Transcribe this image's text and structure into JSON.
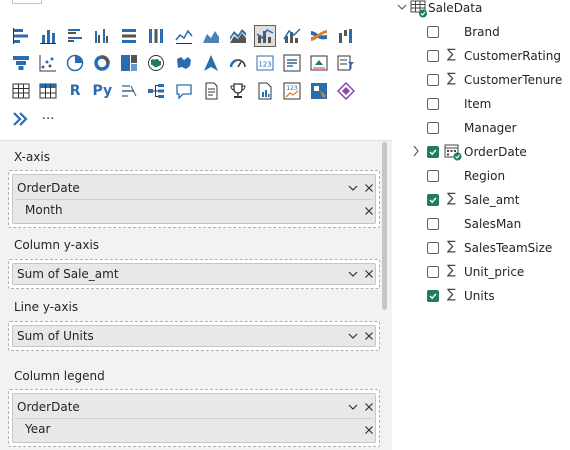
{
  "visualizations": {
    "icons_row1": [
      "stacked-bar-chart-icon",
      "stacked-column-chart-icon",
      "clustered-bar-chart-icon",
      "clustered-column-chart-icon",
      "100-stacked-bar-chart-icon",
      "100-stacked-column-chart-icon",
      "line-chart-icon",
      "area-chart-icon",
      "stacked-area-chart-icon",
      "line-and-column-chart-icon",
      "line-and-clustered-column-chart-icon",
      "ribbon-chart-icon",
      "waterfall-chart-icon"
    ],
    "icons_row2": [
      "funnel-chart-icon",
      "scatter-chart-icon",
      "pie-chart-icon",
      "donut-chart-icon",
      "treemap-icon",
      "map-icon",
      "filled-map-icon",
      "azure-map-icon",
      "gauge-icon",
      "card-icon",
      "multi-row-card-icon",
      "kpi-icon",
      "slicer-icon"
    ],
    "icons_row3": [
      "table-icon",
      "matrix-icon",
      "r-script-visual-icon",
      "python-visual-icon",
      "key-influencers-icon",
      "decomposition-tree-icon",
      "qa-icon",
      "paginated-report-icon",
      "goals-icon",
      "smart-narrative-icon",
      "power-apps-icon",
      "power-automate-icon",
      "diamond-visual-icon"
    ],
    "icons_row4": [
      "power-automate-flow-icon",
      "more-visuals-icon"
    ],
    "more_label": "···",
    "selected_visual": "line-and-clustered-column-chart-icon"
  },
  "wells": {
    "x_axis": {
      "title": "X-axis",
      "field": "OrderDate",
      "sub": "Month"
    },
    "column_y": {
      "title": "Column y-axis",
      "field": "Sum of Sale_amt"
    },
    "line_y": {
      "title": "Line y-axis",
      "field": "Sum of Units"
    },
    "legend": {
      "title": "Column legend",
      "field": "OrderDate",
      "sub": "Year"
    }
  },
  "fields": {
    "table_name": "SaleData",
    "items": [
      {
        "name": "Brand",
        "checked": false,
        "sigma": false
      },
      {
        "name": "CustomerRating",
        "checked": false,
        "sigma": true
      },
      {
        "name": "CustomerTenure",
        "checked": false,
        "sigma": true
      },
      {
        "name": "Item",
        "checked": false,
        "sigma": false
      },
      {
        "name": "Manager",
        "checked": false,
        "sigma": false
      },
      {
        "name": "OrderDate",
        "checked": true,
        "sigma": false,
        "date": true
      },
      {
        "name": "Region",
        "checked": false,
        "sigma": false
      },
      {
        "name": "Sale_amt",
        "checked": true,
        "sigma": true
      },
      {
        "name": "SalesMan",
        "checked": false,
        "sigma": false
      },
      {
        "name": "SalesTeamSize",
        "checked": false,
        "sigma": true
      },
      {
        "name": "Unit_price",
        "checked": false,
        "sigma": true
      },
      {
        "name": "Units",
        "checked": true,
        "sigma": true
      }
    ],
    "sigma_glyph": "∑"
  },
  "colors": {
    "accent_green": "#1a7f5a",
    "accent_blue": "#2b6cb0",
    "pane_bg": "#f3f2f1"
  }
}
